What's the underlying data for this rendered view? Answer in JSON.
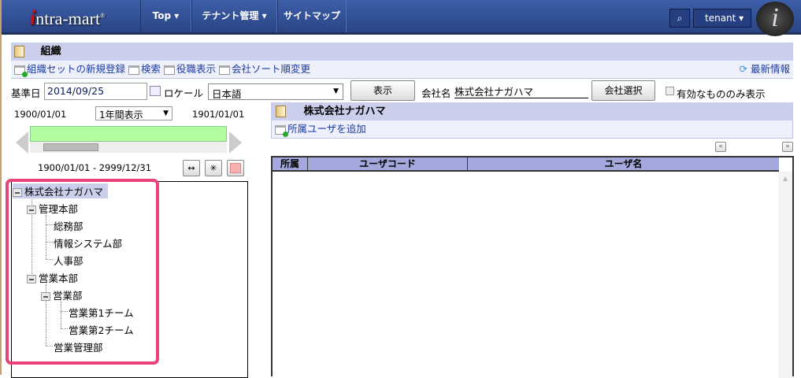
{
  "header": {
    "logo": "intra-mart",
    "nav": [
      {
        "label": "Top ▾"
      },
      {
        "label": "テナント管理 ▾"
      },
      {
        "label": "サイトマップ"
      }
    ],
    "user": "tenant"
  },
  "page": {
    "title": "組織",
    "actions": [
      "組織セットの新規登録",
      "検索",
      "役職表示",
      "会社ソート順変更"
    ],
    "refresh": "最新情報"
  },
  "filters": {
    "date_label": "基準日",
    "date": "2014/09/25",
    "locale_label": "ロケール",
    "locale": "日本語",
    "show_button": "表示",
    "company_label": "会社名",
    "company": "株式会社ナガハマ",
    "company_select": "会社選択",
    "valid_only": "有効なもののみ表示",
    "valid_only_checked": false
  },
  "timeline": {
    "start": "1900/01/01",
    "end": "1901/01/01",
    "period": "1年間表示",
    "range": "1900/01/01 - 2999/12/31"
  },
  "tree": [
    {
      "label": "株式会社ナガハマ",
      "level": 0,
      "expanded": true,
      "selected": true
    },
    {
      "label": "管理本部",
      "level": 1,
      "expanded": true
    },
    {
      "label": "総務部",
      "level": 2
    },
    {
      "label": "情報システム部",
      "level": 2
    },
    {
      "label": "人事部",
      "level": 2
    },
    {
      "label": "営業本部",
      "level": 1,
      "expanded": true
    },
    {
      "label": "営業部",
      "level": 2,
      "expanded": true
    },
    {
      "label": "営業第1チーム",
      "level": 3
    },
    {
      "label": "営業第2チーム",
      "level": 3
    },
    {
      "label": "営業管理部",
      "level": 2
    }
  ],
  "detail": {
    "title": "株式会社ナガハマ",
    "add_user": "所属ユーザを追加",
    "prev": "«",
    "next": "»",
    "columns": [
      "所属",
      "ユーザコード",
      "ユーザ名"
    ],
    "rows": []
  },
  "colors": {
    "header": "#2f4d94",
    "titlebar": "#cccfeb",
    "highlight": "#e8447a"
  }
}
